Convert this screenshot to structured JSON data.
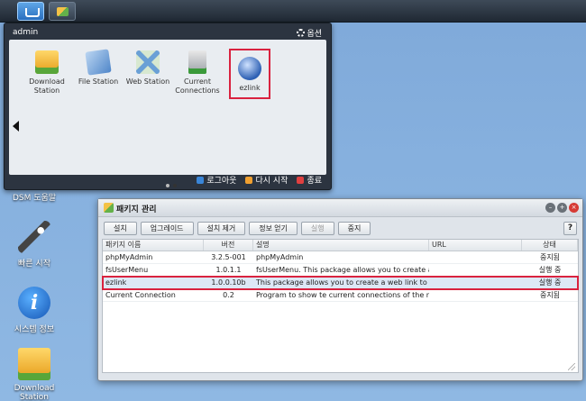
{
  "desktop": {
    "icons": [
      {
        "label": "DSM 도움말"
      },
      {
        "label": "빠른 시작"
      },
      {
        "label": "시스템 정보"
      },
      {
        "label": "Download Station"
      }
    ]
  },
  "start_menu": {
    "user": "admin",
    "options_label": "옵션",
    "apps": [
      {
        "label": "Download Station"
      },
      {
        "label": "File Station"
      },
      {
        "label": "Web Station"
      },
      {
        "label": "Current Connections"
      },
      {
        "label": "ezlink"
      }
    ],
    "page_count": 2,
    "current_page": 2,
    "footer": {
      "logout": "로그아웃",
      "restart": "다시 시작",
      "shutdown": "종료"
    }
  },
  "colors": {
    "logout": "#3a86d8",
    "restart": "#f0a030",
    "shutdown": "#e04040",
    "highlight": "#d9223f"
  },
  "package_manager": {
    "title": "패키지 관리",
    "toolbar": {
      "install": "설치",
      "upgrade": "업그레이드",
      "uninstall": "설치 제거",
      "info": "정보 얻기",
      "run": "실행",
      "stop": "중지",
      "help": "?"
    },
    "columns": {
      "name": "패키지 이름",
      "version": "버전",
      "description": "설명",
      "url": "URL",
      "status": "상태"
    },
    "rows": [
      {
        "name": "phpMyAdmin",
        "version": "3.2.5-001",
        "description": "phpMyAdmin",
        "url": "",
        "status": "중지됨"
      },
      {
        "name": "fsUserMenu",
        "version": "1.0.1.1",
        "description": "fsUserMenu. This package allows you to create a",
        "url": "",
        "status": "실행 중"
      },
      {
        "name": "ezlink",
        "version": "1.0.0.10b",
        "description": "This package allows you to create a web link to s",
        "url": "",
        "status": "실행 중"
      },
      {
        "name": "Current Connection",
        "version": "0.2",
        "description": "Program to show te current connections of the ne",
        "url": "",
        "status": "중지됨"
      }
    ],
    "selected_row": 2
  }
}
